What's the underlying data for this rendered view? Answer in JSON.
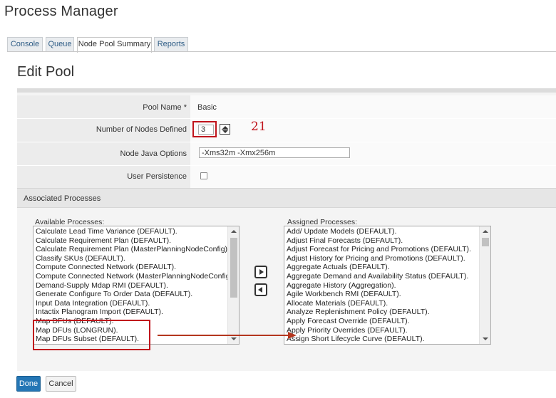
{
  "app": {
    "title": "Process Manager"
  },
  "tabs": [
    {
      "label": "Console",
      "active": false
    },
    {
      "label": "Queue",
      "active": false
    },
    {
      "label": "Node Pool Summary",
      "active": true
    },
    {
      "label": "Reports",
      "active": false
    }
  ],
  "page": {
    "title": "Edit Pool"
  },
  "form": {
    "pool_name": {
      "label": "Pool Name *",
      "value": "Basic"
    },
    "nodes": {
      "label": "Number of Nodes Defined",
      "value": "3",
      "annotation": "21"
    },
    "java_options": {
      "label": "Node Java Options",
      "value": "-Xms32m -Xmx256m"
    },
    "user_persistence": {
      "label": "User Persistence",
      "checked": false
    }
  },
  "associated": {
    "header": "Associated Processes",
    "available_label": "Available Processes:",
    "assigned_label": "Assigned Processes:",
    "available": [
      "Calculate Lead Time Variance (DEFAULT).",
      "Calculate Requirement Plan (DEFAULT).",
      "Calculate Requirement Plan (MasterPlanningNodeConfig).",
      "Classify SKUs (DEFAULT).",
      "Compute Connected Network (DEFAULT).",
      "Compute Connected Network (MasterPlanningNodeConfig).",
      "Demand-Supply Mdap RMI (DEFAULT).",
      "Generate Configure To Order Data (DEFAULT).",
      "Input Data Integration (DEFAULT).",
      "Intactix Planogram Import (DEFAULT).",
      "Map DFUs (DEFAULT).",
      "Map DFUs (LONGRUN).",
      "Map DFUs Subset (DEFAULT)."
    ],
    "assigned": [
      "Add/ Update Models (DEFAULT).",
      "Adjust Final Forecasts (DEFAULT).",
      "Adjust Forecast for Pricing and Promotions (DEFAULT).",
      "Adjust History for Pricing and Promotions (DEFAULT).",
      "Aggregate Actuals (DEFAULT).",
      "Aggregate Demand and Availability Status (DEFAULT).",
      "Aggregate History (Aggregation).",
      "Agile Workbench RMI (DEFAULT).",
      "Allocate Materials (DEFAULT).",
      "Analyze Replenishment Policy (DEFAULT).",
      "Apply Forecast Override (DEFAULT).",
      "Apply Priority Overrides (DEFAULT).",
      "Assign Short Lifecycle Curve (DEFAULT)."
    ],
    "move_right_icon": "arrow-right-icon",
    "move_left_icon": "arrow-left-icon"
  },
  "buttons": {
    "done": "Done",
    "cancel": "Cancel"
  },
  "colors": {
    "primary": "#2476b5",
    "highlight": "#c0141c",
    "annotation_arrow": "#b4361e"
  }
}
